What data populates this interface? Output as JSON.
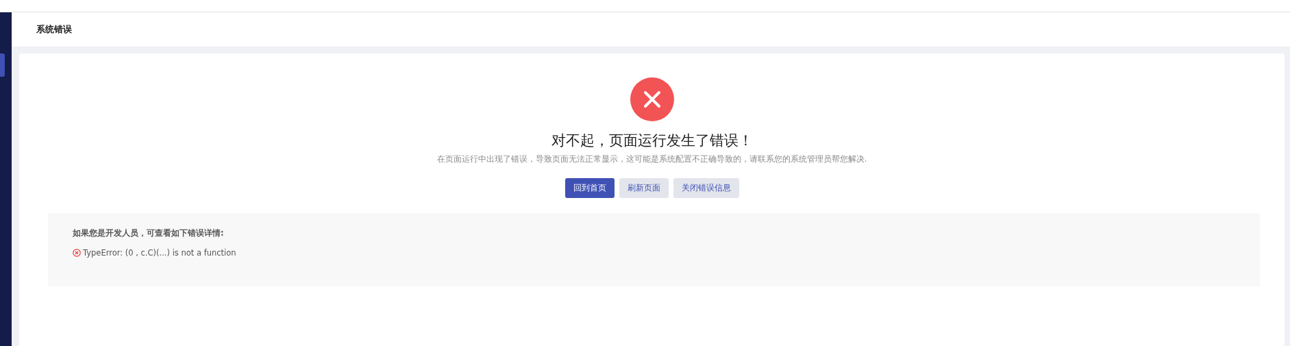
{
  "page_header": {
    "title": "系统错误"
  },
  "error": {
    "title": "对不起，页面运行发生了错误！",
    "message": "在页面运行中出现了错误，导致页面无法正常显示，这可能是系统配置不正确导致的，请联系您的系统管理员帮您解决."
  },
  "buttons": [
    {
      "label": "回到首页",
      "kind": "primary"
    },
    {
      "label": "刷新页面",
      "kind": "secondary"
    },
    {
      "label": "关闭错误信息",
      "kind": "secondary"
    }
  ],
  "details": {
    "heading": "如果您是开发人员，可查看如下错误详情:",
    "error_text": "TypeError: (0 , c.C)(...) is not a function"
  }
}
